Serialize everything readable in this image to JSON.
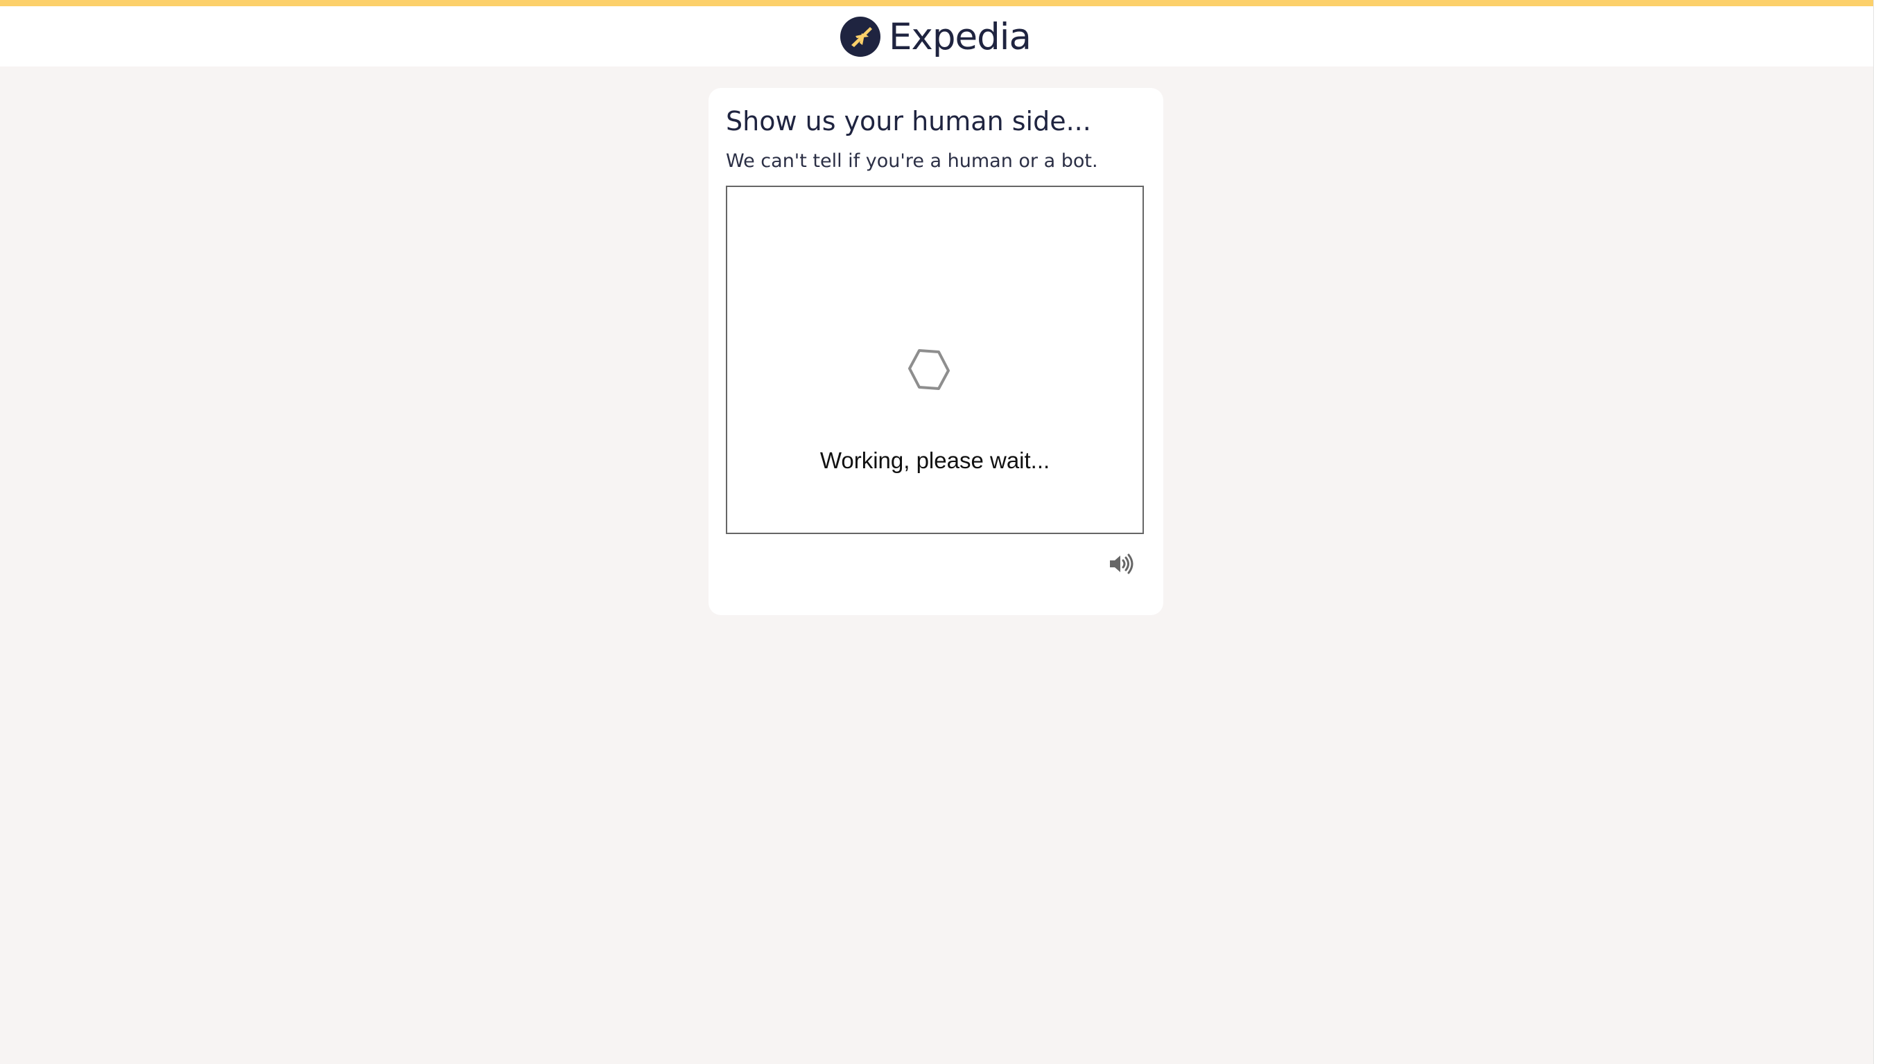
{
  "header": {
    "brand_name": "Expedia",
    "logo_icon": "expedia-plane-logo",
    "accent_color": "#fcd06a",
    "brand_color": "#1f2440"
  },
  "challenge": {
    "title": "Show us your human side...",
    "subtitle": "We can't tell if you're a human or a bot.",
    "status_text": "Working, please wait...",
    "spinner_icon": "hexagon-spinner-icon",
    "audio_icon": "speaker-icon"
  }
}
